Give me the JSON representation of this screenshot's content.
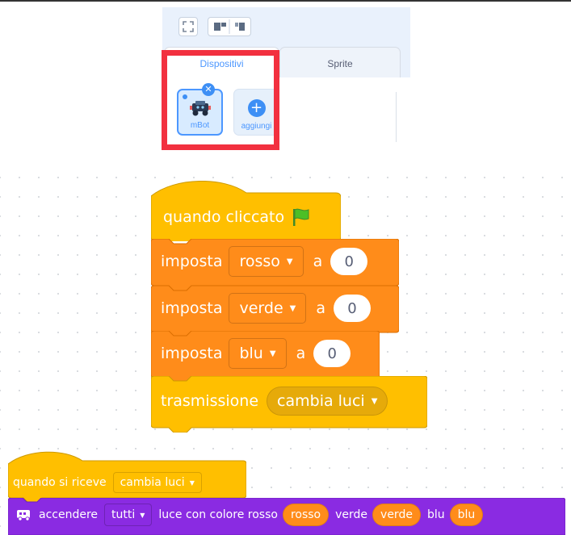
{
  "panel": {
    "tabs": [
      {
        "label": "Dispositivi",
        "active": true
      },
      {
        "label": "Sprite",
        "active": false
      }
    ],
    "devices": [
      {
        "label": "mBot"
      },
      {
        "label": "aggiungi"
      }
    ],
    "close_icon": "close-icon"
  },
  "colors": {
    "events": "#ffbf00",
    "variables": "#ff8c1a",
    "mbot_purple": "#8a2be2",
    "highlight_red": "#f2303f",
    "accent_blue": "#4c97ff"
  },
  "script1": {
    "hat_label": "quando cliccato",
    "set_blocks": [
      {
        "label": "imposta",
        "var": "rosso",
        "to": "a",
        "value": "0"
      },
      {
        "label": "imposta",
        "var": "verde",
        "to": "a",
        "value": "0"
      },
      {
        "label": "imposta",
        "var": "blu",
        "to": "a",
        "value": "0"
      }
    ],
    "broadcast": {
      "label": "trasmissione",
      "message": "cambia luci"
    }
  },
  "script2": {
    "hat_label": "quando si riceve",
    "hat_message": "cambia luci",
    "led": {
      "label": "accendere",
      "target": "tutti",
      "text": "luce con colore rosso",
      "red_value": "rosso",
      "green_label": "verde",
      "green_value": "verde",
      "blue_label": "blu",
      "blue_value": "blu"
    }
  }
}
